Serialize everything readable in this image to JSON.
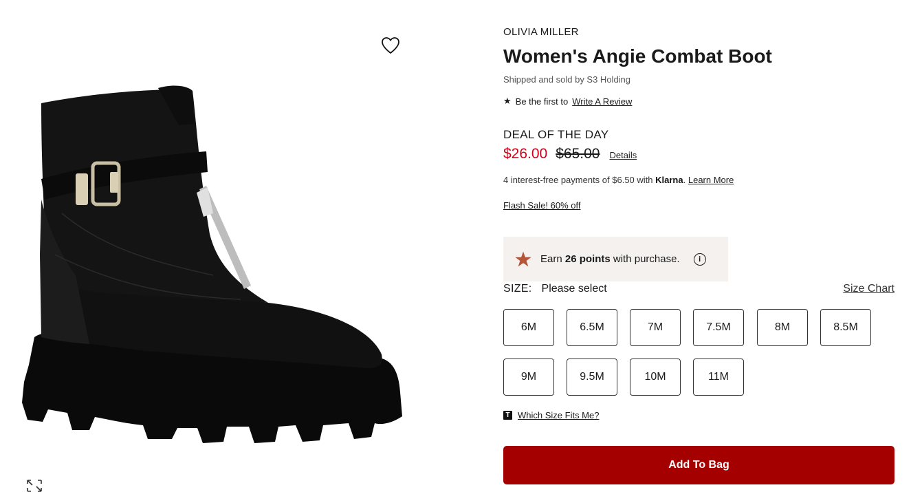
{
  "product": {
    "brand": "OLIVIA MILLER",
    "title": "Women's Angie Combat Boot",
    "shipped": "Shipped and sold by S3 Holding",
    "review_prefix": "Be the first to",
    "review_link": "Write A Review"
  },
  "deal": {
    "label": "DEAL OF THE DAY",
    "sale_price": "$26.00",
    "original_price": "$65.00",
    "details_link": "Details"
  },
  "klarna": {
    "prefix": "4 interest-free payments of $6.50 with",
    "brand": "Klarna",
    "suffix": ".",
    "learn_more": "Learn More"
  },
  "flash_sale": "Flash Sale! 60% off",
  "points": {
    "prefix": "Earn",
    "amount": "26 points",
    "suffix": "with purchase.",
    "info_icon": "i"
  },
  "size": {
    "label": "SIZE:",
    "placeholder": "Please select",
    "chart_link": "Size Chart",
    "options": [
      "6M",
      "6.5M",
      "7M",
      "7.5M",
      "8M",
      "8.5M",
      "9M",
      "9.5M",
      "10M",
      "11M"
    ],
    "fit_link": "Which Size Fits Me?",
    "fit_icon_letter": "T"
  },
  "actions": {
    "add_to_bag": "Add To Bag"
  },
  "colors": {
    "sale_red": "#d0021b",
    "button_red": "#a50000",
    "points_star": "#b5553a",
    "points_bg": "#f4f1ef"
  },
  "icons": [
    "heart-outline-icon",
    "expand-icon",
    "star-icon",
    "info-icon",
    "t-logo-icon"
  ]
}
